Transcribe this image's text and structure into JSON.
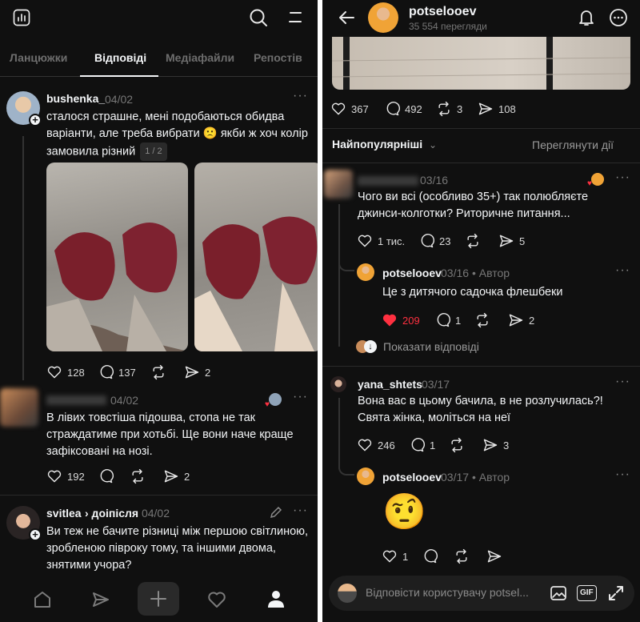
{
  "left": {
    "tabs": [
      "Ланцюжки",
      "Відповіді",
      "Медіафайли",
      "Репостів"
    ],
    "posts": [
      {
        "user": "bushenka_",
        "date": "04/02",
        "text": "сталося страшне, мені подобаються обидва варіанти, але треба вибрати 🙁 якби ж хоч колір замовила різний",
        "badge": "1 / 2",
        "likes": "128",
        "comments": "137",
        "shares": "2"
      },
      {
        "user": "",
        "date": "04/02",
        "text": "В лівих товстіша підошва, стопа не так страждатиме при хотьбі. Ще вони наче краще зафіксовані на нозі.",
        "likes": "192",
        "shares": "2"
      },
      {
        "user": "svitlea",
        "reply_to": "› доіпісля",
        "date": "04/02",
        "text": "Ви теж не бачите різниці між першою світлиною, зробленою півроку тому, та іншими двома, знятими учора?"
      }
    ],
    "nav": [
      "home-icon",
      "send-icon",
      "compose-icon",
      "heart-icon",
      "profile-icon"
    ]
  },
  "right": {
    "header": {
      "title": "potselooev",
      "subtitle": "35 554 перегляди"
    },
    "post_stats": {
      "likes": "367",
      "comments": "492",
      "reposts": "3",
      "shares": "108"
    },
    "sort": {
      "label": "Найпопулярніші",
      "view_activity": "Переглянути дії"
    },
    "comments": [
      {
        "user": "",
        "date": "03/16",
        "text": "Чого ви всі (особливо 35+) так полюбляєте джинси-колготки? Риторичне питання...",
        "likes": "1 тис.",
        "comments": "23",
        "shares": "5"
      },
      {
        "user": "potselooev",
        "date": "03/16",
        "author_tag": "• Автор",
        "text": "Це з дитячого садочка флешбеки",
        "likes": "209",
        "comments": "1",
        "shares": "2"
      },
      {
        "show_replies": "Показати відповіді"
      },
      {
        "user": "yana_shtets",
        "date": "03/17",
        "text": "Вона вас в цьому бачила, в не розлучилась?! Свята жінка, моліться на неї",
        "likes": "246",
        "comments": "1",
        "shares": "3"
      },
      {
        "user": "potselooev",
        "date": "03/17",
        "author_tag": "• Автор",
        "emoji": "🤨",
        "likes": "1"
      }
    ],
    "reply_input": {
      "placeholder": "Відповісти користувачу potsel...",
      "gif": "GIF"
    }
  },
  "colors": {
    "bg": "#101010",
    "liked": "#ff3040",
    "muted": "#777777"
  }
}
